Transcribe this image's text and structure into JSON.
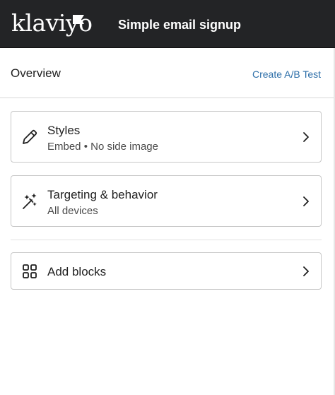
{
  "header": {
    "logo_text": "klaviyo",
    "title": "Simple email signup"
  },
  "overview": {
    "title": "Overview",
    "ab_test_link": "Create A/B Test"
  },
  "cards": {
    "styles": {
      "title": "Styles",
      "subtitle": "Embed • No side image",
      "icon": "pencil-icon"
    },
    "targeting": {
      "title": "Targeting & behavior",
      "subtitle": "All devices",
      "icon": "magic-wand-icon"
    },
    "blocks": {
      "title": "Add blocks",
      "icon": "grid-icon"
    }
  },
  "colors": {
    "header_bg": "#232426",
    "link": "#2c6ea8",
    "border": "#c8c8c8"
  }
}
